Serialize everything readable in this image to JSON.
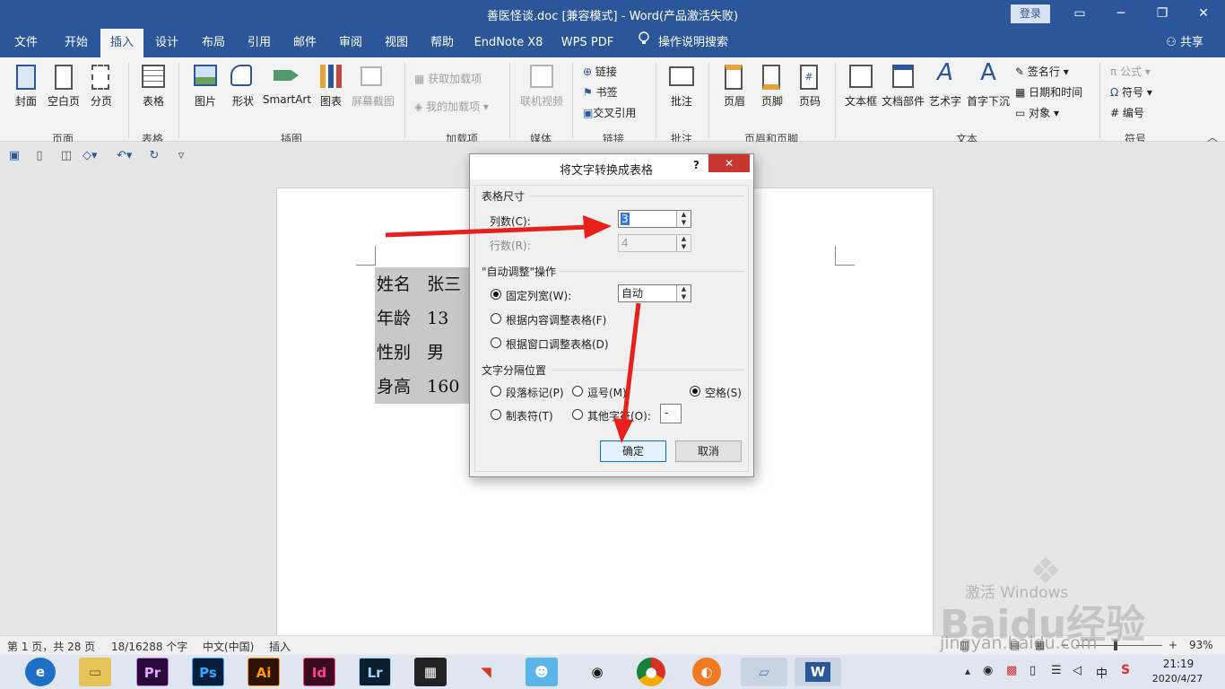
{
  "app": {
    "title": "善医怪谈.doc [兼容模式]  -  Word(产品激活失败)",
    "login": "登录",
    "win_min": "▭",
    "win_restore": "─",
    "win_max": "❐",
    "win_close": "✕"
  },
  "tabs": [
    "文件",
    "开始",
    "插入",
    "设计",
    "布局",
    "引用",
    "邮件",
    "审阅",
    "视图",
    "帮助",
    "EndNote X8",
    "WPS PDF",
    "操作说明搜索"
  ],
  "share": "共享",
  "ribbon": {
    "pages": {
      "cover": "封面",
      "blank": "空白页",
      "break": "分页",
      "group": "页面"
    },
    "tables": {
      "table": "表格",
      "group": "表格"
    },
    "illustrations": {
      "picture": "图片",
      "shapes": "形状",
      "smartart": "SmartArt",
      "chart": "图表",
      "screenshot": "屏幕截图",
      "group": "插图"
    },
    "addins": {
      "get": "获取加载项",
      "my": "我的加载项",
      "group": "加载项"
    },
    "media": {
      "video": "联机视频",
      "group": "媒体"
    },
    "links": {
      "link": "链接",
      "bookmark": "书签",
      "crossref": "交叉引用",
      "group": "链接"
    },
    "comments": {
      "comment": "批注",
      "group": "批注"
    },
    "headerfooter": {
      "header": "页眉",
      "footer": "页脚",
      "pagenum": "页码",
      "group": "页眉和页脚"
    },
    "text": {
      "textbox": "文本框",
      "quickparts": "文档部件",
      "wordart": "艺术字",
      "dropcap": "首字下沉",
      "sigline": "签名行",
      "datetime": "日期和时间",
      "object": "对象",
      "group": "文本"
    },
    "symbols": {
      "equation": "公式",
      "symbol": "符号",
      "numbering": "编号",
      "group": "符号"
    }
  },
  "document": {
    "rows": [
      [
        "姓名",
        "张三"
      ],
      [
        "年龄",
        "13"
      ],
      [
        "性别",
        "男"
      ],
      [
        "身高",
        "160"
      ]
    ]
  },
  "dialog": {
    "title": "将文字转换成表格",
    "help": "?",
    "close": "✕",
    "size_section": "表格尺寸",
    "cols_label": "列数(C):",
    "cols_value": "3",
    "rows_label": "行数(R):",
    "rows_value": "4",
    "autofit_section": "\"自动调整\"操作",
    "fixed_label": "固定列宽(W):",
    "fixed_value": "自动",
    "fit_content": "根据内容调整表格(F)",
    "fit_window": "根据窗口调整表格(D)",
    "sep_section": "文字分隔位置",
    "sep_para": "段落标记(P)",
    "sep_comma": "逗号(M)",
    "sep_space": "空格(S)",
    "sep_tab": "制表符(T)",
    "sep_other": "其他字符(O):",
    "sep_other_value": "-",
    "ok": "确定",
    "cancel": "取消"
  },
  "status": {
    "page": "第 1 页，共 28 页",
    "words": "18/16288 个字",
    "lang": "中文(中国)",
    "mode": "插入",
    "zoom": "93%"
  },
  "taskbar": {
    "time": "21:19",
    "date": "2020/4/27",
    "ime": "中",
    "apps": [
      "Pr",
      "Ps",
      "Ai",
      "Id",
      "Lr"
    ]
  },
  "watermark": {
    "text": "Baidu经验",
    "url": "jingyan.baidu.com",
    "activate": "激活 Windows"
  },
  "colors": {
    "accent": "#2b579a",
    "arrow": "#e8201c"
  }
}
